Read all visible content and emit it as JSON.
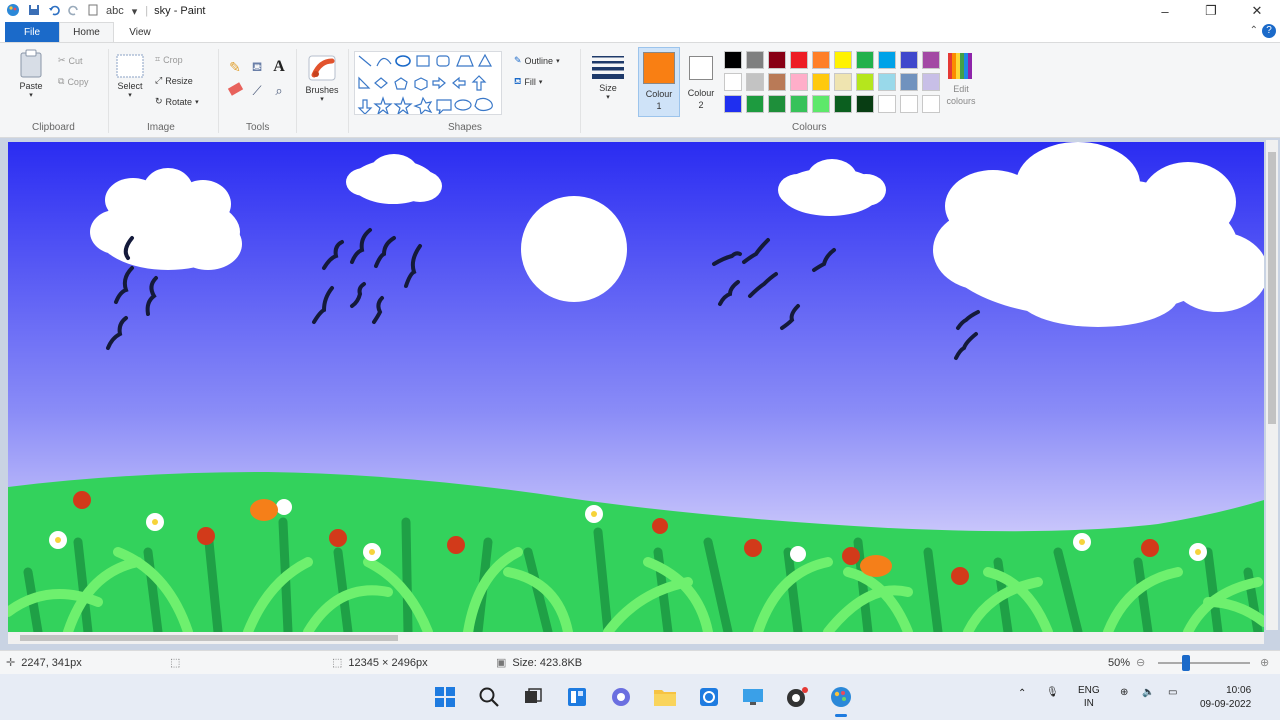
{
  "app": {
    "title": "sky - Paint",
    "quick_access_label": "abc"
  },
  "menu": {
    "file": "File",
    "home": "Home",
    "view": "View",
    "help": "?"
  },
  "ribbon": {
    "clipboard": {
      "label": "Clipboard",
      "paste": "Paste",
      "cut": "Cut",
      "copy": "Copy"
    },
    "image": {
      "label": "Image",
      "select": "Select",
      "crop": "Crop",
      "resize": "Resize",
      "rotate": "Rotate"
    },
    "tools": {
      "label": "Tools"
    },
    "brushes": "Brushes",
    "shapes": {
      "label": "Shapes",
      "outline": "Outline",
      "fill": "Fill"
    },
    "size": "Size",
    "colour1": "Colour 1",
    "colour2": "Colour 2",
    "colours": {
      "label": "Colours",
      "edit": "Edit colours"
    }
  },
  "colours": {
    "colour1": "#f97f13",
    "colour2": "#ffffff",
    "palette_row1": [
      "#000000",
      "#7f7f7f",
      "#880015",
      "#ed1c24",
      "#ff7f27",
      "#fff200",
      "#22b14c",
      "#00a2e8",
      "#3f48cc",
      "#a349a4"
    ],
    "palette_row2": [
      "#ffffff",
      "#c3c3c3",
      "#b97a57",
      "#ffaec9",
      "#ffc90e",
      "#efe4b0",
      "#b5e61d",
      "#99d9ea",
      "#7092be",
      "#c8bfe7"
    ],
    "palette_row3": [
      "#1f2ff0",
      "#1d9b3f",
      "#1e8f3a",
      "#37c25a",
      "#5de86a",
      "#0b5f1f",
      "#083d13",
      "#ffffff",
      "#ffffff",
      "#ffffff"
    ]
  },
  "status": {
    "cursor": "2247, 341px",
    "dimensions": "12345 × 2496px",
    "size": "Size: 423.8KB",
    "zoom": "50%"
  },
  "taskbar": {
    "lang_line1": "ENG",
    "lang_line2": "IN",
    "time": "10:06",
    "date": "09-09-2022"
  }
}
